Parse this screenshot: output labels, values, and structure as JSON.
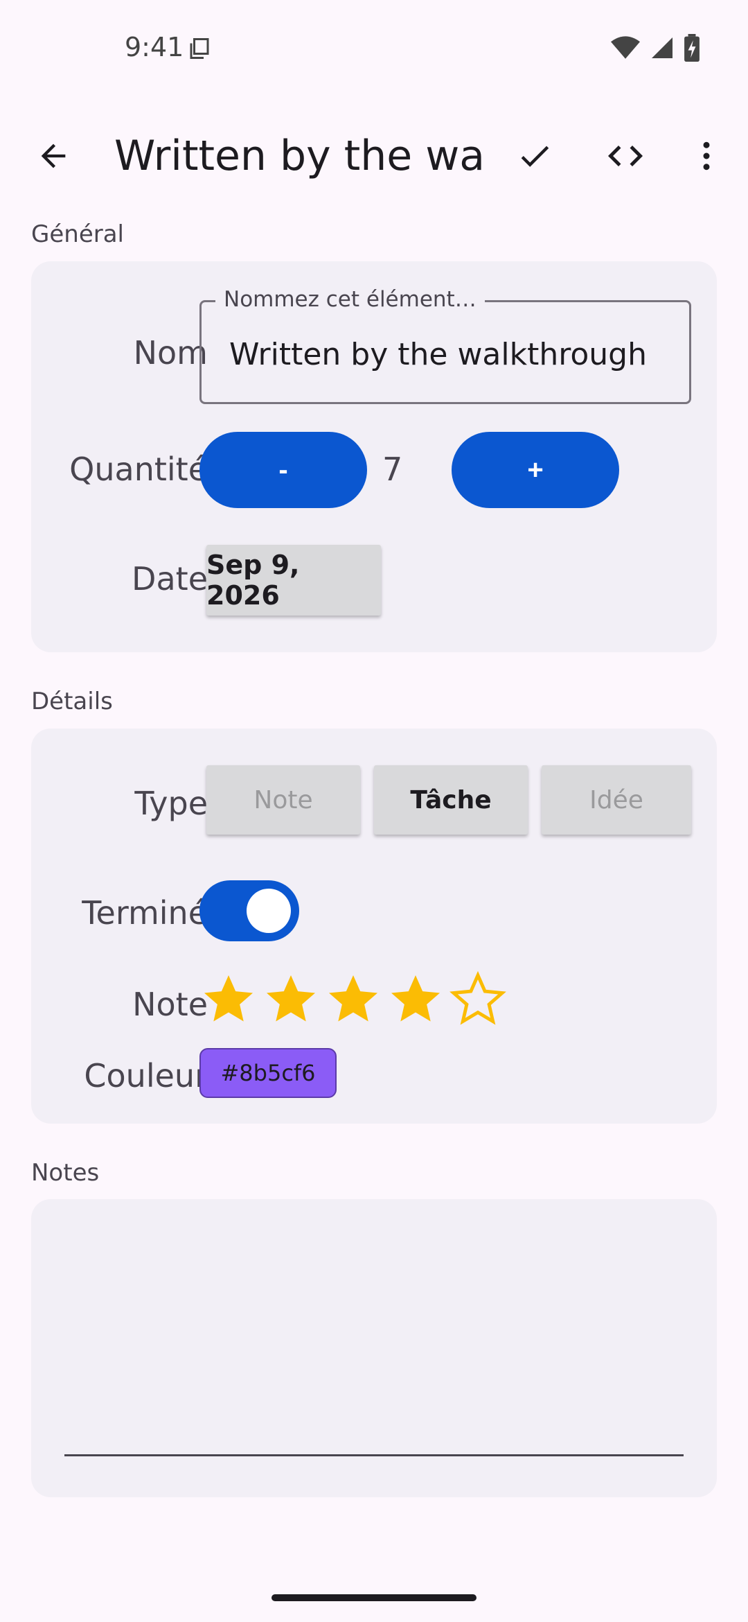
{
  "status_bar": {
    "time": "9:41"
  },
  "app_bar": {
    "title": "Written by the wal…"
  },
  "sections": {
    "general": "Général",
    "details": "Détails",
    "notes": "Notes"
  },
  "form": {
    "name_label": "Nom",
    "name_field_label": "Nommez cet élément…",
    "name_value": "Written by the walkthrough",
    "quantity_label": "Quantité",
    "decrement_label": "-",
    "increment_label": "+",
    "quantity_value": "7",
    "date_label": "Date",
    "date_value": "Sep 9, 2026",
    "type_label": "Type",
    "type_options": [
      "Note",
      "Tâche",
      "Idée"
    ],
    "type_selected": "Tâche",
    "done_label": "Terminé",
    "done_value": true,
    "rating_label": "Note",
    "rating_value": 4,
    "rating_max": 5,
    "color_label": "Couleur",
    "color_value": "#8b5cf6",
    "notes_value": ""
  },
  "colors": {
    "accent": "#0b57d0",
    "star": "#fbbc04",
    "background": "#fdf7fd",
    "card": "#f2eff6"
  },
  "icons": [
    "back-arrow-icon",
    "check-icon",
    "code-icon",
    "more-vert-icon",
    "wifi-icon",
    "signal-icon",
    "battery-icon"
  ]
}
